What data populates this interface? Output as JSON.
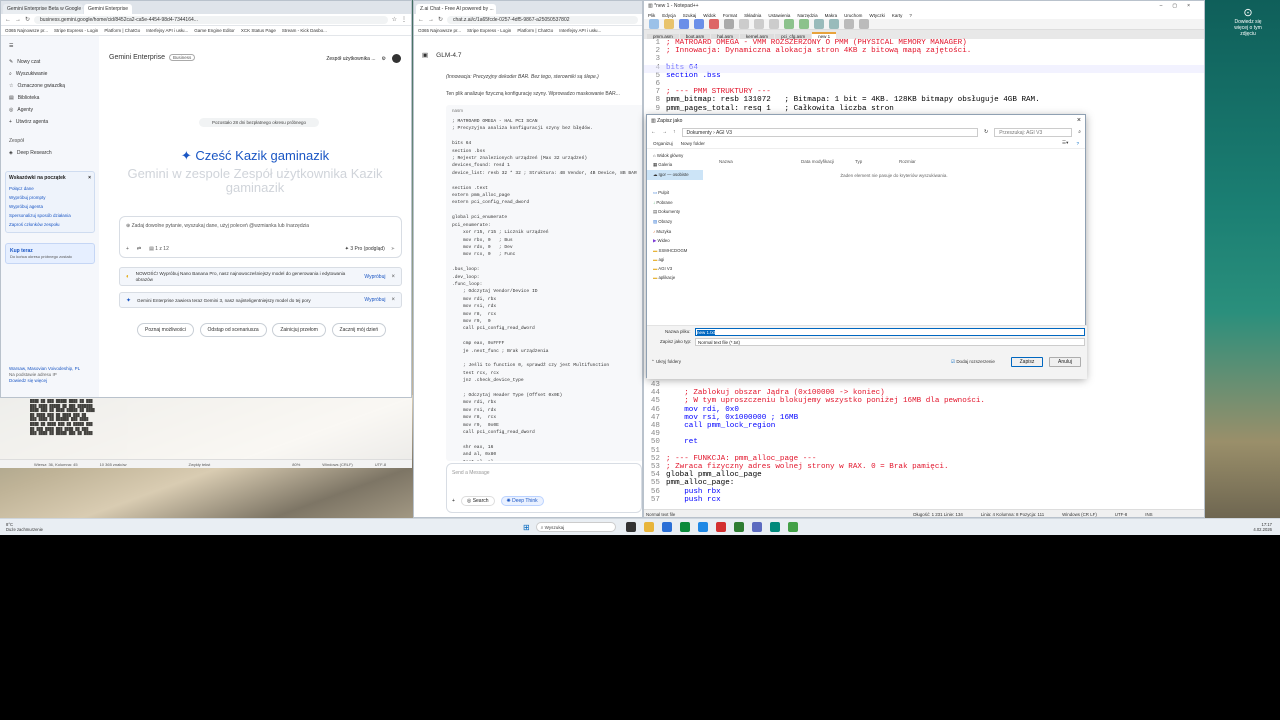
{
  "gemini": {
    "tabs": [
      "Gemini Enterprise Beta w Google C...",
      "Gemini Enterprise"
    ],
    "url": "business.gemini.google/home/cid/8452ca2-ca5e-4454-98d4-7344164...",
    "bookmarks": [
      "O365 Najnowsze pr...",
      "Stripe Express - Login",
      "Platform | ChatGo",
      "Interfejsy API i usłu...",
      "Game Engine Editor",
      "XCK Status Page",
      "Stream - Kick Dasbo..."
    ],
    "brand": "Gemini Enterprise",
    "badge": "Business",
    "team": "Zespół użytkownika ...",
    "nav": [
      "Nowy czat",
      "Wyszukiwanie",
      "Oznaczone gwiazdką",
      "Biblioteka",
      "Agenty",
      "Utwórz agenta"
    ],
    "section_label": "Zespół",
    "deep_research": "Deep Research",
    "start_title": "Wskazówki na początek",
    "start_items": [
      "Połącz dane",
      "Wypróbuj prompty",
      "Wypróbuj agenta",
      "Spersonalizuj sposób działania",
      "Zaproś członków zespołu"
    ],
    "buy_title": "Kup teraz",
    "buy_sub": "Do końca okresu próbnego zostało",
    "trial_notice": "Pozostało 28 dni bezpłatnego okresu próbnego",
    "greeting": "Cześć Kazik gaminazik",
    "welcome": "Gemini w zespole Zespół użytkownika Kazik gaminazik",
    "input_placeholder": "Zadaj dowolne pytanie, wyszukaj dane, użyj poleceń @wzmianka lub /narzędzia",
    "pager": "1 z 12",
    "model": "3 Pro (podgląd)",
    "notices": [
      {
        "text": "NOWOŚĆ! Wypróbuj Nano Banana Pro, nasz najnowocześniejszy model do generowania i edytowania obrazów",
        "action": "Wypróbuj"
      },
      {
        "text": "Gemini Enterprise zawiera teraz Gemini 3, nasz najinteligentniejszy model do tej pory",
        "action": "Wypróbuj"
      }
    ],
    "chips": [
      "Poznaj możliwości",
      "Odstąp od scenariusza",
      "Zainicjuj przełom",
      "Zacznij mój dzień"
    ],
    "location": "Warsaw, Masovian Voivodeship, PL",
    "location_sub": "Na podstawie adresu IP",
    "location_link": "Dowiedz się więcej"
  },
  "zai": {
    "tab": "Z.ai Chat - Free AI powered by ...",
    "url": "chat.z.ai/c/1a65fcde-0257-4df5-9867-a25050537802",
    "bookmarks": [
      "O365 Najnowsze pr...",
      "Stripe Express - Login",
      "Platform | ChatGo",
      "Interfejsy API i usłu..."
    ],
    "model": "GLM-4.7",
    "intro_italic": "(Innowacja: Precyzyjny dekoder BAR. Bez tego, sterowniki są ślepe.)",
    "intro": "Ten plik analizuje fizyczną konfigurację szyny. Wprowadzo maskowanie BAR...",
    "code_lang": "nasm",
    "code": "; MATROARD OMEGA - HAL PCI SCAN\n; Precyzyjna analiza konfiguracji szyny bez błędów.\n\nbits 64\nsection .bss\n; Rejestr znalezionych urządzeń (Max 32 urządzeń)\ndevices_found: resd 1\ndevice_list: resb 32 * 32 ; Struktura: 4B Vendor, 4B Device, 8B BAR\n\nsection .text\nextern pmm_alloc_page\nextern pci_config_read_dword\n\nglobal pci_enumerate\npci_enumerate:\n    xor r15, r15 ; Licznik urządzeń\n    mov rbx, 0   ; Bus\n    mov rdx, 0   ; Dev\n    mov rcx, 0   ; Func\n\n.bus_loop:\n.dev_loop:\n.func_loop:\n    ; Odczytaj Vendor/Device ID\n    mov rdi, rbx\n    mov rsi, rdx\n    mov r8,  rcx\n    mov r9,  0\n    call pci_config_read_dword\n\n    cmp eax, 0xFFFF\n    je .next_func ; Brak urządzenia\n\n    ; Jeśli to function 0, sprawdź czy jest Multifunction\n    test rcx, rcx\n    jnz .check_device_type\n\n    ; Odczytaj Header Type (Offset 0x0E)\n    mov rdi, rbx\n    mov rsi, rdx\n    mov r8,  rcx\n    mov r9,  0x0E\n    call pci_config_read_dword\n\n    shr eax, 16\n    and al, 0x80\n    test al, al",
    "send_placeholder": "Send a Message",
    "search_label": "Search",
    "deep_label": "Deep Think"
  },
  "notepad": {
    "title": "*new 1 - Notepad++",
    "menu": [
      "Plik",
      "Edycja",
      "Szukaj",
      "Widok",
      "Format",
      "Składnia",
      "Ustawienia",
      "Narzędzia",
      "Makra",
      "Uruchom",
      "Wtyczki",
      "Karty",
      "?"
    ],
    "tabs": [
      "pmm.asm",
      "boot.asm",
      "hal.asm",
      "kernel.asm",
      "pci_cfg.asm",
      "new 1"
    ],
    "lines_top": [
      {
        "n": "1",
        "t": "; MATROARD OMEGA - VMM ROZSZERZONY O PMM (PHYSICAL MEMORY MANAGER)",
        "c": "#e2142b"
      },
      {
        "n": "2",
        "t": "; Innowacja: Dynamiczna alokacja stron 4KB z bitową mapą zajętości.",
        "c": "#e2142b"
      },
      {
        "n": "3",
        "t": "",
        "c": "#000"
      },
      {
        "n": "4",
        "t": "bits 64",
        "c": "#0000ff"
      },
      {
        "n": "5",
        "t": "section .bss",
        "c": "#0000ff"
      },
      {
        "n": "6",
        "t": "",
        "c": "#000"
      },
      {
        "n": "7",
        "t": "; --- PMM STRUKTURY ---",
        "c": "#e2142b"
      },
      {
        "n": "8",
        "t": "pmm_bitmap: resb 131072   ; Bitmapa: 1 bit = 4KB. 128KB bitmapy obsługuje 4GB RAM.",
        "c": "#000"
      },
      {
        "n": "9",
        "t": "pmm_pages_total: resq 1   ; Całkowita liczba stron",
        "c": "#000"
      }
    ],
    "lines_bottom": [
      {
        "n": "43",
        "t": "",
        "c": "#000"
      },
      {
        "n": "44",
        "t": "    ; Zablokuj obszar Jądra (0x100000 -> koniec)",
        "c": "#e2142b"
      },
      {
        "n": "45",
        "t": "    ; W tym uproszczeniu blokujemy wszystko poniżej 16MB dla pewności.",
        "c": "#e2142b"
      },
      {
        "n": "46",
        "t": "    mov rdi, 0x0",
        "c": "#0000ff"
      },
      {
        "n": "47",
        "t": "    mov rsi, 0x1000000 ; 16MB",
        "c": "#0000ff"
      },
      {
        "n": "48",
        "t": "    call pmm_lock_region",
        "c": "#0000ff"
      },
      {
        "n": "49",
        "t": "",
        "c": "#000"
      },
      {
        "n": "50",
        "t": "    ret",
        "c": "#0000ff"
      },
      {
        "n": "51",
        "t": "",
        "c": "#000"
      },
      {
        "n": "52",
        "t": "; --- FUNKCJA: pmm_alloc_page ---",
        "c": "#e2142b"
      },
      {
        "n": "53",
        "t": "; Zwraca fizyczny adres wolnej strony w RAX. 0 = Brak pamięci.",
        "c": "#e2142b"
      },
      {
        "n": "54",
        "t": "global pmm_alloc_page",
        "c": "#000"
      },
      {
        "n": "55",
        "t": "pmm_alloc_page:",
        "c": "#000"
      },
      {
        "n": "56",
        "t": "    push rbx",
        "c": "#0000ff"
      },
      {
        "n": "57",
        "t": "    push rcx",
        "c": "#0000ff"
      }
    ],
    "status": {
      "type": "Normal text file",
      "length": "Długość: 1 231   Linie: 134",
      "pos": "Linia: 4   Kolumna: 8   Pozycja: 111",
      "eol": "Windows (CR LF)",
      "enc": "UTF-8",
      "ins": "INS"
    }
  },
  "save_dialog": {
    "title": "Zapisz jako",
    "breadcrumb": "Dokumenty  ›  AGI V3",
    "search": "Przeszukaj: AGI V3",
    "organize": "Organizuj",
    "new_folder": "Nowy folder",
    "columns": [
      "Nazwa",
      "Data modyfikacji",
      "Typ",
      "Rozmiar"
    ],
    "empty": "Żaden element nie pasuje do kryteriów wyszukiwania.",
    "tree": [
      "Widok główny",
      "Galeria",
      "Igor — osobiste",
      "Pulpit",
      "Pobrane",
      "Dokumenty",
      "Obrazy",
      "Muzyka",
      "Wideo",
      "SSMHCDOGM",
      "agi",
      "AGI V3",
      "aplikacje"
    ],
    "filename_label": "Nazwa pliku:",
    "filename": "new 1.txt",
    "type_label": "Zapisz jako typ:",
    "type_value": "Normal text file (*.txt)",
    "hide_folders": "Ukryj foldery",
    "append_ext": "Dodaj rozszerzenie",
    "save": "Zapisz",
    "cancel": "Anuluj"
  },
  "explorer_bg": {
    "status": [
      "Wiersz: 36, Kolumna: 45",
      "10 365 znaków",
      "Zwykły tekst",
      "80%",
      "Windows (CRLF)",
      "UTF-8"
    ]
  },
  "taskbar": {
    "weather": "8°C",
    "weather_sub": "Duże zachmurzenie",
    "search": "Wyszukaj",
    "time": "17:17",
    "date": "4.02.2026"
  },
  "desktop": {
    "notice": "Dowiedz się więcej o tym zdjęciu"
  }
}
